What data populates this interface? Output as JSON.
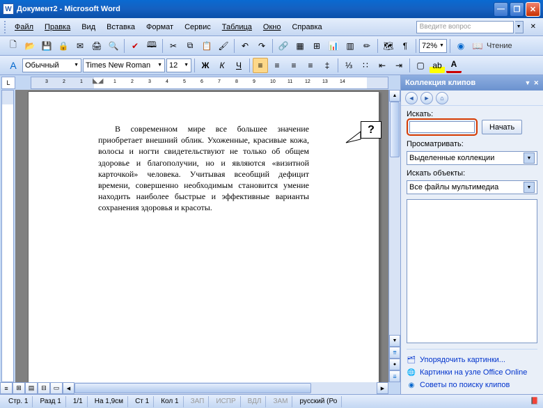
{
  "window": {
    "title": "Документ2 - Microsoft Word",
    "app_initial": "W"
  },
  "menu": {
    "file": "Файл",
    "edit": "Правка",
    "view": "Вид",
    "insert": "Вставка",
    "format": "Формат",
    "tools": "Сервис",
    "table": "Таблица",
    "window": "Окно",
    "help": "Справка",
    "ask_placeholder": "Введите вопрос"
  },
  "formatting": {
    "style": "Обычный",
    "font": "Times New Roman",
    "size": "12",
    "zoom": "72%",
    "reading": "Чтение"
  },
  "ruler": {
    "marks": [
      "3",
      "2",
      "1",
      "",
      "1",
      "2",
      "3",
      "4",
      "5",
      "6",
      "7",
      "8",
      "9",
      "10",
      "11",
      "12",
      "13",
      "14"
    ],
    "corner": "L"
  },
  "document": {
    "paragraph": "В современном мире все большее значение приобретает внешний облик. Ухоженные, красивые кожа, волосы и ногти свидетельствуют не только об общем здоровье и благополучии, но и являются «визитной карточкой» человека. Учитывая всеобщий дефицит времени, совершенно необходимым становится умение находить наиболее быстрые и эффективные варианты сохранения здоровья и красоты."
  },
  "callout": {
    "mark": "?"
  },
  "taskpane": {
    "title": "Коллекция клипов",
    "search_label": "Искать:",
    "search_value": "",
    "start": "Начать",
    "browse_label": "Просматривать:",
    "browse_value": "Выделенные коллекции",
    "objects_label": "Искать объекты:",
    "objects_value": "Все файлы мультимедиа",
    "links": {
      "organize": "Упорядочить картинки...",
      "online": "Картинки на узле Office Online",
      "tips": "Советы по поиску клипов"
    }
  },
  "status": {
    "page": "Стр. 1",
    "section": "Разд 1",
    "pages": "1/1",
    "at": "На 1,9см",
    "line": "Ст 1",
    "col": "Кол 1",
    "rec": "ЗАП",
    "fix": "ИСПР",
    "ext": "ВДЛ",
    "ovr": "ЗАМ",
    "lang": "русский (Ро"
  }
}
